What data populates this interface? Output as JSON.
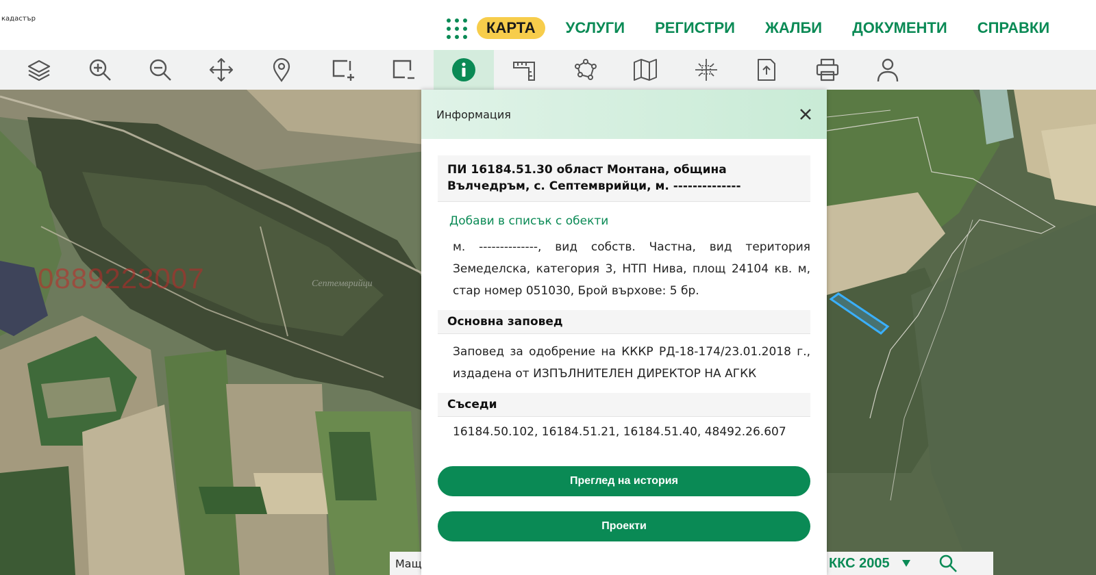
{
  "logo": {
    "text": "кадастър"
  },
  "nav": {
    "items": [
      {
        "label": "КАРТА",
        "active": true
      },
      {
        "label": "УСЛУГИ"
      },
      {
        "label": "РЕГИСТРИ"
      },
      {
        "label": "ЖАЛБИ"
      },
      {
        "label": "ДОКУМЕНТИ"
      },
      {
        "label": "СПРАВКИ"
      }
    ]
  },
  "toolbar": {
    "tools": [
      {
        "icon": "layers-icon"
      },
      {
        "icon": "zoom-in-icon"
      },
      {
        "icon": "zoom-out-icon"
      },
      {
        "icon": "pan-icon"
      },
      {
        "icon": "location-pin-icon"
      },
      {
        "icon": "select-add-icon"
      },
      {
        "icon": "select-remove-icon"
      },
      {
        "icon": "info-icon",
        "active": true
      },
      {
        "icon": "ruler-icon"
      },
      {
        "icon": "polygon-icon"
      },
      {
        "icon": "map-icon"
      },
      {
        "icon": "coordinates-icon"
      },
      {
        "icon": "export-icon"
      },
      {
        "icon": "print-icon"
      },
      {
        "icon": "user-icon"
      }
    ]
  },
  "map": {
    "watermark_phone": "0889223007",
    "watermark_place": "Септемврийци"
  },
  "info_panel": {
    "title": "Информация",
    "object_title": "ПИ 16184.51.30 област Монтана, община Вълчедръм, с. Септемврийци, м. --------------",
    "add_link": "Добави в списък с обекти",
    "description": "м. --------------, вид собств. Частна, вид територия Земеделска, категория 3, НТП Нива, площ 24104 кв. м, стар номер 051030, Брой върхове: 5 бр.",
    "order_heading": "Основна заповед",
    "order_text": "Заповед за одобрение на КККР РД-18-174/23.01.2018 г., издадена от ИЗПЪЛНИТЕЛЕН ДИРЕКТОР НА АГКК",
    "neighbors_heading": "Съседи",
    "neighbors_text": "16184.50.102, 16184.51.21, 16184.51.40, 48492.26.607",
    "history_button": "Преглед на история",
    "projects_button": "Проекти"
  },
  "bottom": {
    "scale_label": "Мащаб",
    "crs_label": "ККС 2005"
  },
  "colors": {
    "brand_green": "#0a8a55",
    "active_nav": "#f7cd4b",
    "parcel_highlight": "#3ab0ff"
  }
}
